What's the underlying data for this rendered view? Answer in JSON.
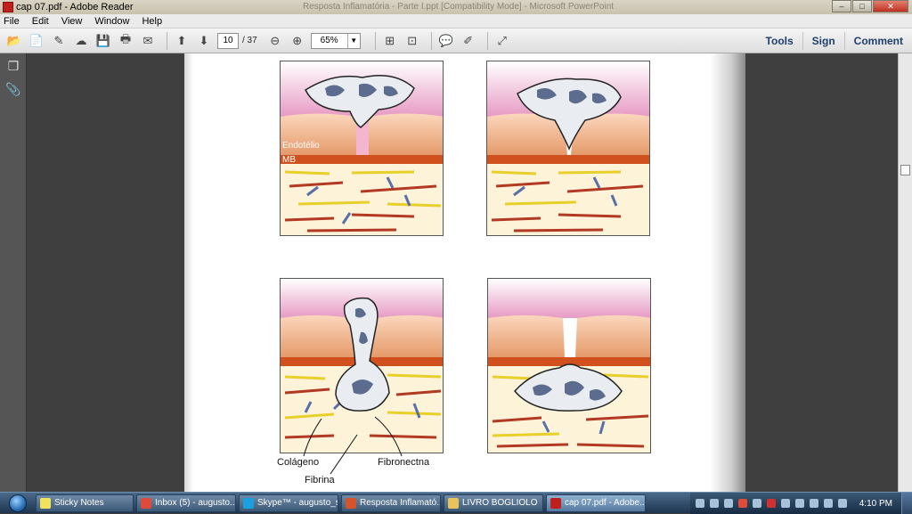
{
  "window": {
    "title": "cap 07.pdf - Adobe Reader",
    "background_title": "Resposta Inflamatória - Parte I.ppt [Compatibility Mode] - Microsoft PowerPoint",
    "buttons": {
      "minimize": "–",
      "maximize": "□",
      "close": "✕"
    }
  },
  "menu": [
    "File",
    "Edit",
    "View",
    "Window",
    "Help"
  ],
  "toolbar": {
    "current_page": "10",
    "total_pages": "/ 37",
    "zoom": "65%",
    "tools_label": "Tools",
    "sign_label": "Sign",
    "comment_label": "Comment"
  },
  "figure": {
    "labels": {
      "endotelio": "Endotélio",
      "mb": "MB",
      "colageno": "Colágeno",
      "fibrina": "Fibrina",
      "fibronectina": "Fibronectna"
    }
  },
  "taskbar": {
    "items": [
      {
        "label": "Sticky Notes",
        "color": "#f2e15a"
      },
      {
        "label": "Inbox (5) - augusto...",
        "color": "#e04a3a"
      },
      {
        "label": "Skype™ - augusto_s...",
        "color": "#1aa0e0"
      },
      {
        "label": "Resposta Inflamató...",
        "color": "#d5552a"
      },
      {
        "label": "LIVRO BOGLIOLO",
        "color": "#e8c25a"
      },
      {
        "label": "cap 07.pdf - Adobe...",
        "color": "#c0201d"
      }
    ],
    "clock": "4:10 PM"
  }
}
